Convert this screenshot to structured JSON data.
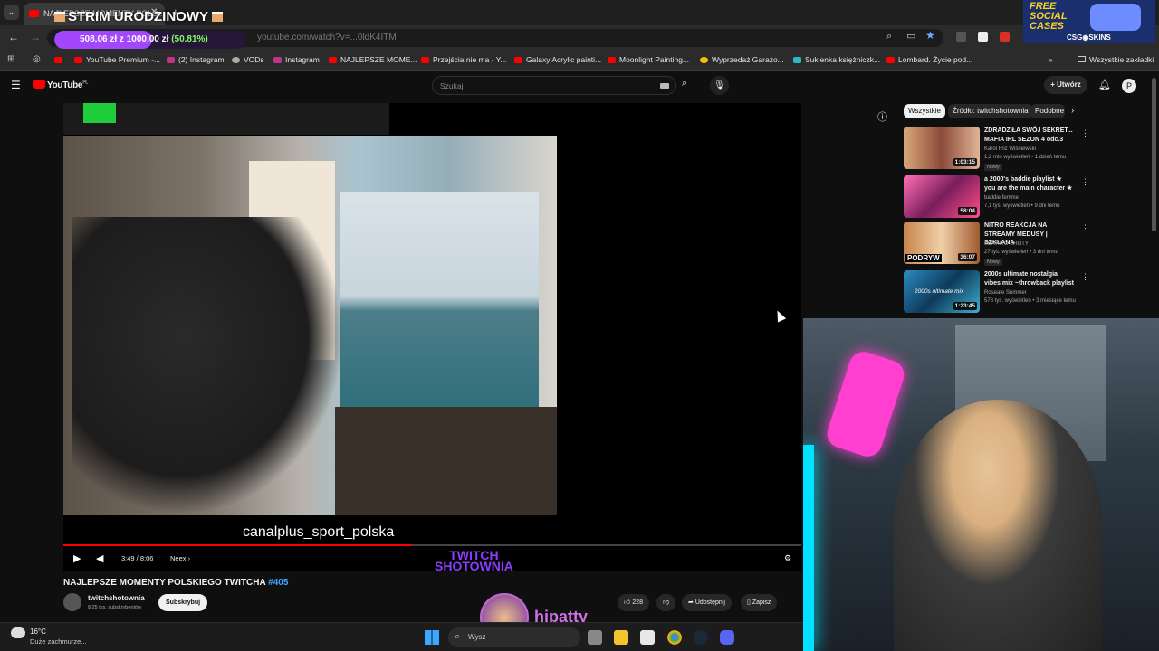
{
  "browser": {
    "tab_title": "NAJLEPSZE MOMENTY POLS...",
    "url": "youtube.com/watch?v=...0ldK4ITM",
    "bookmarks": [
      "YouTube Premium -...",
      "(2) Instagram",
      "VODs",
      "Instagram",
      "NAJLEPSZE MOME...",
      "Przejścia nie ma - Y...",
      "Galaxy Acrylic painti...",
      "Moonlight Painting...",
      "Wyprzedaż Garażo...",
      "Sukienka księżniczk...",
      "Lombard. Życie pod..."
    ],
    "all_bookmarks": "Wszystkie zakładki"
  },
  "overlay": {
    "stream_title": "STRIM URODZINOWY",
    "goal_text": "508,06 zł z 1000,00 zł",
    "goal_percent": "(50.81%)",
    "goal_fraction": 0.5081,
    "sponsor_line1": "FREE",
    "sponsor_line2": "SOCIAL",
    "sponsor_line3": "CASES",
    "sponsor_brand": "CSG",
    "sponsor_brand2": "SKINS",
    "streamer_name": "hipatty"
  },
  "youtube": {
    "logo": "YouTube",
    "logo_sup": "PL",
    "search_placeholder": "Szukaj",
    "create_label": "Utwórz",
    "video": {
      "title": "NAJLEPSZE MOMENTY POLSKIEGO TWITCHA",
      "hashtag": "#405",
      "channel": "twitchshotownia",
      "subs": "8,25 tys. subskrybentów",
      "subscribe": "Subskrybuj",
      "likes": "228",
      "share": "Udostępnij",
      "save": "Zapisz",
      "time": "3:49 / 8:06",
      "chapter": "Neex",
      "progress": 0.473,
      "watermark1": "TWITCH",
      "watermark2": "SHOTOWNIA",
      "inner_text": "canalplus_sport_polska"
    },
    "chips": [
      "Wszystkie",
      "Źródło: twitchshotownia",
      "Podobne"
    ],
    "recommended": [
      {
        "title": "ZDRADZIŁA SWÓJ SEKRET... MAFIA IRL SEZON 4 odc.3",
        "channel": "Karol Friz Wiśniewski",
        "meta": "1,2 mln wyświetleń • 1 dzień temu",
        "badge": "Nowy",
        "duration": "1:03:15"
      },
      {
        "title": "a 2000's baddie playlist ★ you are the main character ★",
        "channel": "baddie femme",
        "meta": "7,1 tys. wyświetleń • 9 dni temu",
        "badge": "",
        "duration": "58:04"
      },
      {
        "title": "NITRO REAKCJA NA STREAMY MEDUSY | SZKLANA",
        "channel": "SERHITO SHOTY",
        "meta": "27 tys. wyświetleń • 3 dni temu",
        "badge": "Nowy",
        "duration": "36:07",
        "thumb_text": "PODRYW"
      },
      {
        "title": "2000s ultimate nostalgia vibes mix ~throwback playlist",
        "channel": "Roseate Summer",
        "meta": "578 tys. wyświetleń • 3 miesiące temu",
        "badge": "",
        "duration": "1:23:45",
        "thumb_text": "2000s ultimate mix"
      }
    ]
  },
  "taskbar": {
    "temp": "16°C",
    "weather": "Duże zachmurze...",
    "search": "Wysz"
  },
  "colors": {
    "accent": "#ff0000",
    "goal": "#a347ff",
    "watermark": "#8b3dff"
  }
}
